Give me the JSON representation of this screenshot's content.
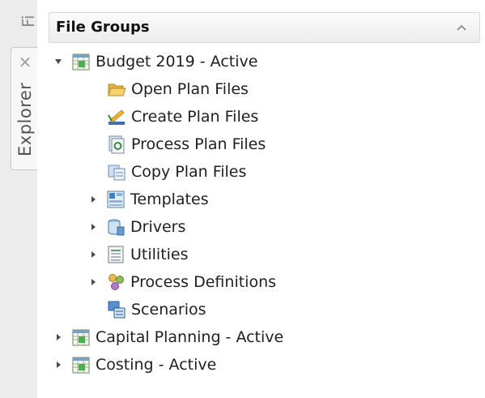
{
  "tabs": {
    "side_tab_partial_label": "Fi",
    "explorer_label": "Explorer",
    "explorer_close": "×"
  },
  "panel": {
    "title": "File Groups"
  },
  "tree": [
    {
      "label": "Budget 2019 - Active",
      "icon": "file-group-icon",
      "toggle": "expanded"
    },
    {
      "label": "Open Plan Files",
      "icon": "open-folder-icon",
      "toggle": "none"
    },
    {
      "label": "Create Plan Files",
      "icon": "create-plan-files-icon",
      "toggle": "none"
    },
    {
      "label": "Process Plan Files",
      "icon": "process-plan-files-icon",
      "toggle": "none"
    },
    {
      "label": "Copy Plan Files",
      "icon": "copy-plan-files-icon",
      "toggle": "none"
    },
    {
      "label": "Templates",
      "icon": "templates-icon",
      "toggle": "collapsed"
    },
    {
      "label": "Drivers",
      "icon": "drivers-icon",
      "toggle": "collapsed"
    },
    {
      "label": "Utilities",
      "icon": "utilities-icon",
      "toggle": "collapsed"
    },
    {
      "label": "Process Definitions",
      "icon": "process-definitions-icon",
      "toggle": "collapsed"
    },
    {
      "label": "Scenarios",
      "icon": "scenarios-icon",
      "toggle": "none"
    },
    {
      "label": "Capital Planning - Active",
      "icon": "file-group-icon",
      "toggle": "collapsed"
    },
    {
      "label": "Costing - Active",
      "icon": "file-group-icon",
      "toggle": "collapsed"
    }
  ]
}
